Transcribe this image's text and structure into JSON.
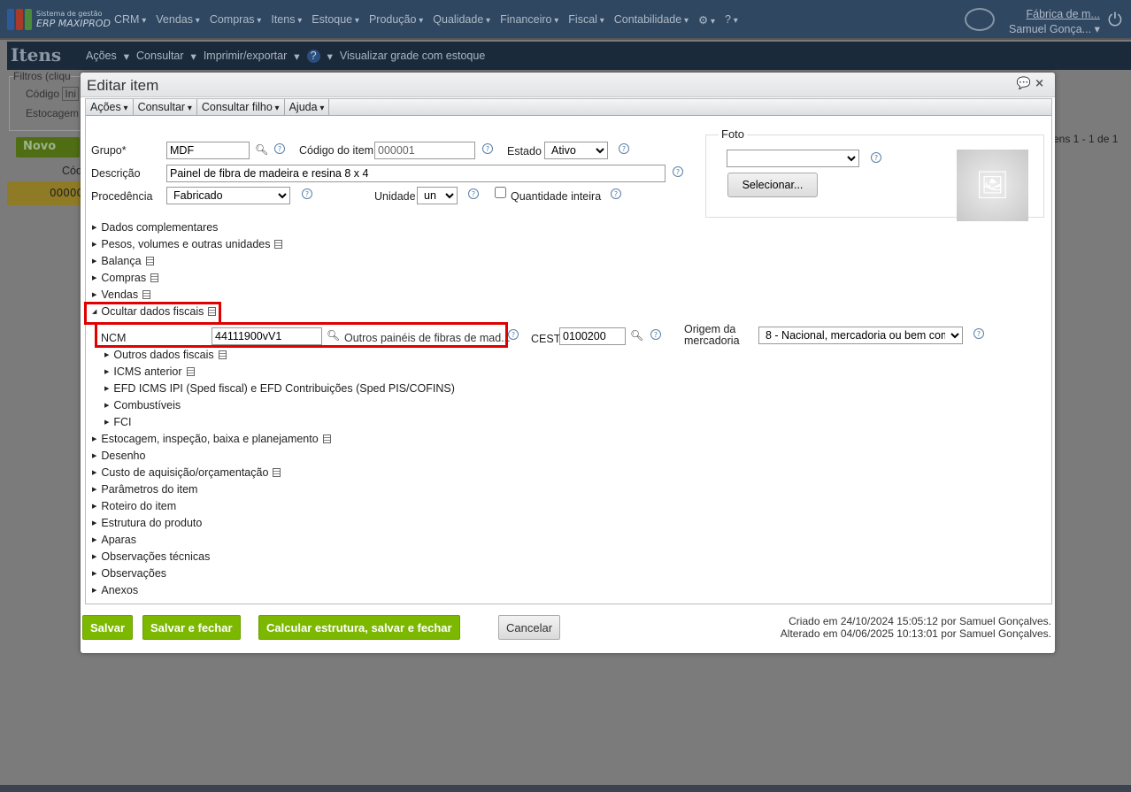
{
  "app": {
    "logo_line1": "Sistema de gestão",
    "logo_line2": "ERP MAXIPROD",
    "menu": [
      "CRM",
      "Vendas",
      "Compras",
      "Itens",
      "Estoque",
      "Produção",
      "Qualidade",
      "Financeiro",
      "Fiscal",
      "Contabilidade"
    ],
    "company": "Fábrica de m...",
    "user": "Samuel Gonça..."
  },
  "page": {
    "title": "Itens",
    "menu": [
      "Ações",
      "Consultar",
      "Imprimir/exportar",
      "?",
      "Visualizar grade com estoque"
    ],
    "filters_label": "Filtros (cliqu",
    "codigo": "Código",
    "codigo_val": "Ini",
    "estocagem": "Estocagem",
    "novo": "Novo",
    "col": "Cód",
    "row_code": "00000",
    "pager": "ens 1 - 1 de 1"
  },
  "modal": {
    "title": "Editar item",
    "toolbar": [
      "Ações",
      "Consultar",
      "Consultar filho",
      "Ajuda"
    ],
    "grupo_label": "Grupo*",
    "grupo": "MDF",
    "codigo_label": "Código do item",
    "codigo": "000001",
    "estado_label": "Estado",
    "estado": "Ativo",
    "descricao_label": "Descrição",
    "descricao": "Painel de fibra de madeira e resina 8 x 4",
    "procedencia_label": "Procedência",
    "procedencia": "Fabricado",
    "unidade_label": "Unidade",
    "unidade": "un",
    "qtd_inteira": "Quantidade inteira",
    "foto_label": "Foto",
    "selecionar": "Selecionar...",
    "sections": [
      "Dados complementares",
      "Pesos, volumes e outras unidades",
      "Balança",
      "Compras",
      "Vendas",
      "Ocultar dados fiscais"
    ],
    "ncm_label": "NCM",
    "ncm": "44111900vV1",
    "ncm_desc": "Outros painéis de fibras de mad...",
    "cest_label": "CEST",
    "cest": "0100200",
    "origem_label": "Origem da mercadoria",
    "origem": "8 - Nacional, mercadoria ou bem com c",
    "fiscal_sub": [
      "Outros dados fiscais",
      "ICMS anterior",
      "EFD ICMS IPI (Sped fiscal) e EFD Contribuições (Sped PIS/COFINS)",
      "Combustíveis",
      "FCI"
    ],
    "sections2": [
      "Estocagem, inspeção, baixa e planejamento",
      "Desenho",
      "Custo de aquisição/orçamentação",
      "Parâmetros do item",
      "Roteiro do item",
      "Estrutura do produto",
      "Aparas",
      "Observações técnicas",
      "Observações",
      "Anexos"
    ],
    "buttons": {
      "salvar": "Salvar",
      "salvar_fechar": "Salvar e fechar",
      "calcular": "Calcular estrutura, salvar e fechar",
      "cancelar": "Cancelar"
    },
    "created": "Criado em 24/10/2024 15:05:12 por Samuel Gonçalves.",
    "altered": "Alterado em 04/06/2025 10:13:01 por Samuel Gonçalves."
  }
}
